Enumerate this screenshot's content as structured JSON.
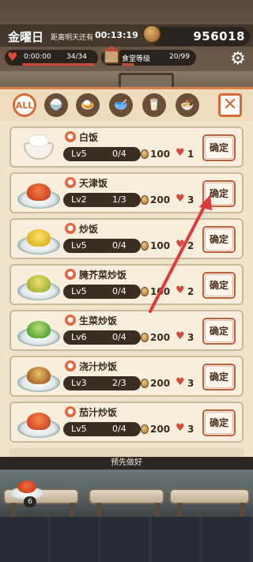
{
  "header": {
    "day": "金曜日",
    "until_label": "距离明天还有",
    "countdown": "00:13:19",
    "coins": "956018"
  },
  "stats": {
    "time": "0:00:00",
    "progress": "34/34",
    "shop_label": "食堂等级",
    "shop_progress": "20/99"
  },
  "filters": {
    "all_label": "ALL",
    "icons": [
      "rice-bowl-icon",
      "dish-icon",
      "soup-bowl-icon",
      "drink-glass-icon",
      "noodle-bowl-icon"
    ]
  },
  "confirm_label": "确定",
  "dishes": [
    {
      "name": "白饭",
      "level": "Lv5",
      "count": "0/4",
      "price": "100",
      "hearts": "1",
      "food": "rice"
    },
    {
      "name": "天津饭",
      "level": "Lv2",
      "count": "1/3",
      "price": "200",
      "hearts": "3",
      "food": "tianjin"
    },
    {
      "name": "炒饭",
      "level": "Lv5",
      "count": "0/4",
      "price": "100",
      "hearts": "2",
      "food": "fried"
    },
    {
      "name": "腌芥菜炒饭",
      "level": "Lv5",
      "count": "0/4",
      "price": "100",
      "hearts": "2",
      "food": "mustard"
    },
    {
      "name": "生菜炒饭",
      "level": "Lv6",
      "count": "0/4",
      "price": "200",
      "hearts": "3",
      "food": "lettuce"
    },
    {
      "name": "浇汁炒饭",
      "level": "Lv3",
      "count": "2/3",
      "price": "200",
      "hearts": "3",
      "food": "sauce"
    },
    {
      "name": "茄汁炒饭",
      "level": "Lv5",
      "count": "0/4",
      "price": "200",
      "hearts": "3",
      "food": "tomato"
    }
  ],
  "prepared": {
    "header": "预先做好",
    "badge": "6"
  },
  "colors": {
    "accent": "#d46a38",
    "heart": "#d64a3a",
    "arrow": "#e03a3a"
  }
}
